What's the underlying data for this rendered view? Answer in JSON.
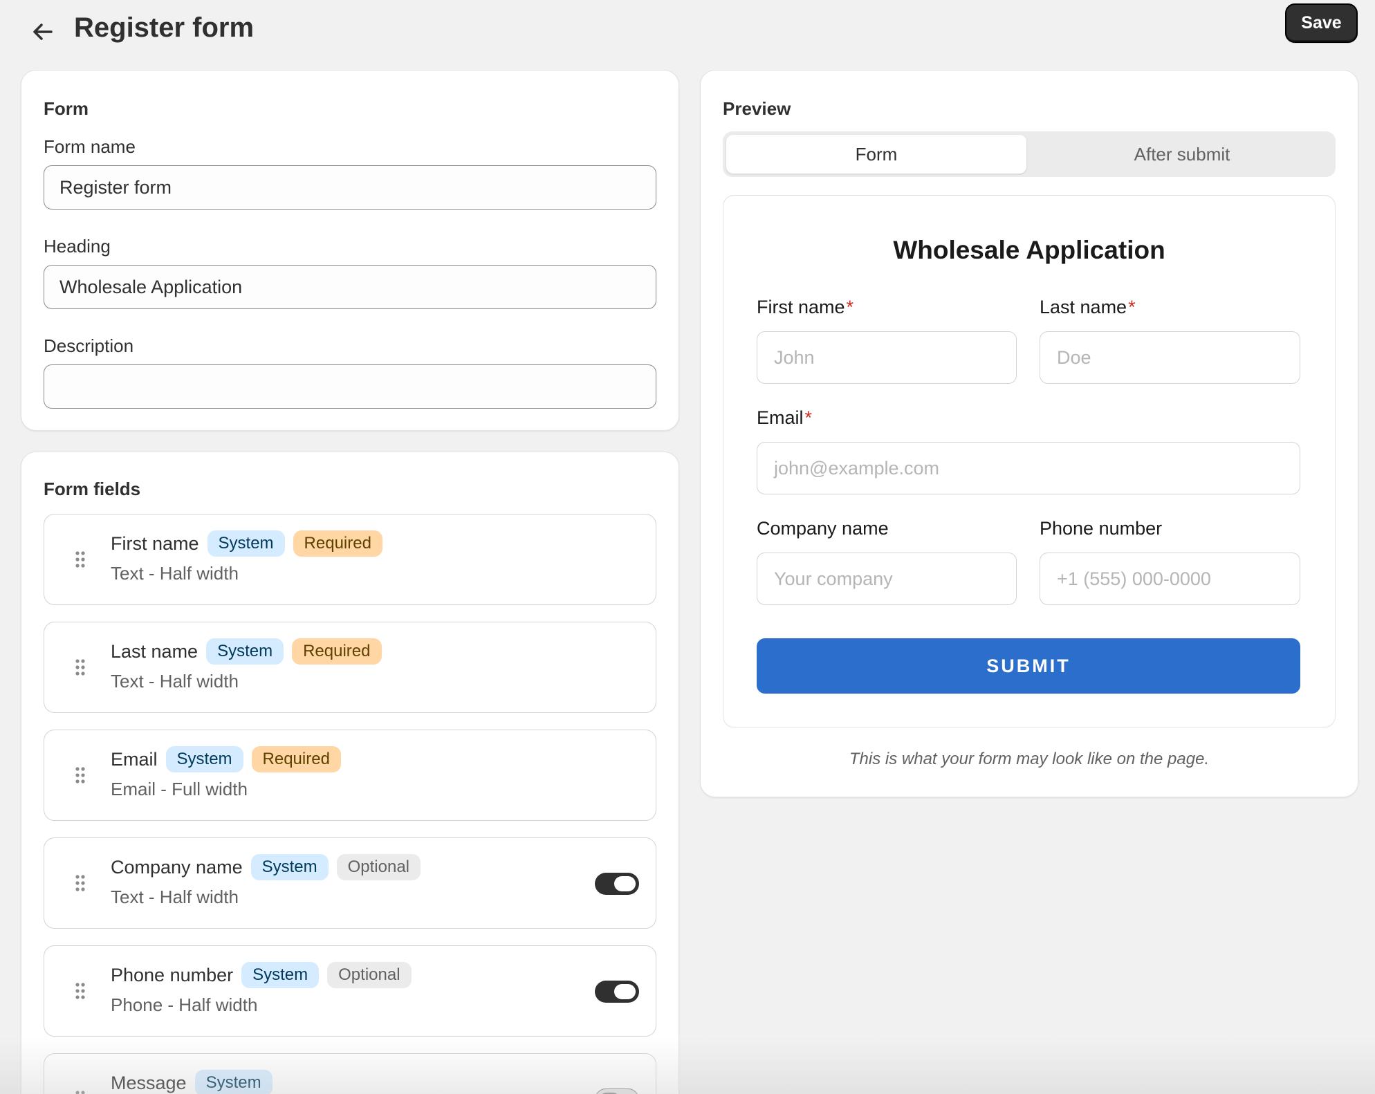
{
  "header": {
    "title": "Register form",
    "back_icon": "arrow-left-icon",
    "save_label": "Save"
  },
  "form_card": {
    "title": "Form",
    "form_name": {
      "label": "Form name",
      "value": "Register form"
    },
    "heading": {
      "label": "Heading",
      "value": "Wholesale Application"
    },
    "description": {
      "label": "Description",
      "value": ""
    }
  },
  "fields_card": {
    "title": "Form fields",
    "fields": [
      {
        "name": "First name",
        "badges": [
          "System",
          "Required"
        ],
        "sub": "Text - Half width",
        "toggle": null
      },
      {
        "name": "Last name",
        "badges": [
          "System",
          "Required"
        ],
        "sub": "Text - Half width",
        "toggle": null
      },
      {
        "name": "Email",
        "badges": [
          "System",
          "Required"
        ],
        "sub": "Email - Full width",
        "toggle": null
      },
      {
        "name": "Company name",
        "badges": [
          "System",
          "Optional"
        ],
        "sub": "Text - Half width",
        "toggle": "on"
      },
      {
        "name": "Phone number",
        "badges": [
          "System",
          "Optional"
        ],
        "sub": "Phone - Half width",
        "toggle": "on"
      },
      {
        "name": "Message",
        "badges": [
          "System"
        ],
        "sub": "",
        "toggle": "off"
      }
    ]
  },
  "preview": {
    "title": "Preview",
    "tabs": [
      "Form",
      "After submit"
    ],
    "active_tab": "Form",
    "heading": "Wholesale Application",
    "first_name": {
      "label": "First name",
      "placeholder": "John"
    },
    "last_name": {
      "label": "Last name",
      "placeholder": "Doe"
    },
    "email": {
      "label": "Email",
      "placeholder": "john@example.com"
    },
    "company": {
      "label": "Company name",
      "placeholder": "Your company"
    },
    "phone": {
      "label": "Phone number",
      "placeholder": "+1 (555) 000-0000"
    },
    "required_marker": "*",
    "submit_label": "SUBMIT",
    "caption": "This is what your form may look like on the page."
  },
  "colors": {
    "submit": "#2c6ecb",
    "badge_system": "#d5ebff",
    "badge_required": "#ffd6a4",
    "badge_optional": "#ebebeb",
    "required_star": "#d12d20"
  }
}
